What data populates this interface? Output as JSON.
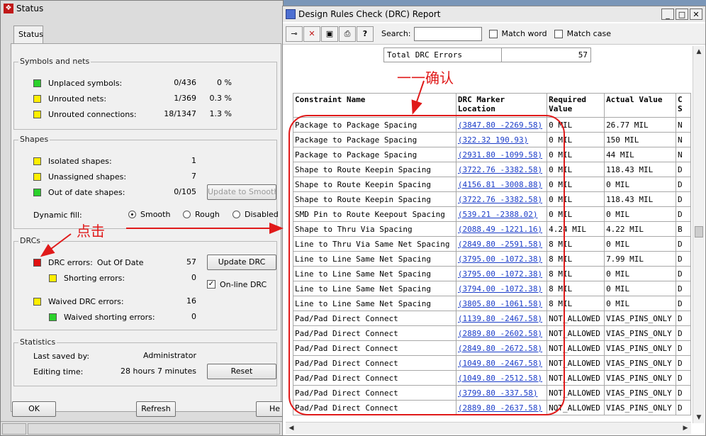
{
  "status_window": {
    "title": "Status",
    "tab": "Status",
    "symbols_nets": {
      "label": "Symbols and nets",
      "rows": [
        {
          "name": "Unplaced symbols:",
          "count": "0/436",
          "pct": "0 %",
          "color": "#2bd12b"
        },
        {
          "name": "Unrouted nets:",
          "count": "1/369",
          "pct": "0.3 %",
          "color": "#ffee00"
        },
        {
          "name": "Unrouted connections:",
          "count": "18/1347",
          "pct": "1.3 %",
          "color": "#ffee00"
        }
      ]
    },
    "shapes": {
      "label": "Shapes",
      "isolated": {
        "name": "Isolated shapes:",
        "value": "1"
      },
      "unassigned": {
        "name": "Unassigned shapes:",
        "value": "7"
      },
      "out_of_date": {
        "name": "Out of date shapes:",
        "value": "0/105"
      },
      "update_to_smooth": "Update to Smooth",
      "dynamic_fill_label": "Dynamic fill:",
      "fill_options": [
        "Smooth",
        "Rough",
        "Disabled"
      ],
      "fill_selected": "Smooth"
    },
    "drcs": {
      "label": "DRCs",
      "drc_errors": {
        "name": "DRC errors:",
        "state": "Out Of Date",
        "value": "57"
      },
      "shorting_errors": {
        "name": "Shorting errors:",
        "value": "0"
      },
      "waived_drc_errors": {
        "name": "Waived DRC errors:",
        "value": "16"
      },
      "waived_shorting_errors": {
        "name": "Waived shorting errors:",
        "value": "0"
      },
      "update_drc": "Update DRC",
      "online_drc": "On-line DRC"
    },
    "statistics": {
      "label": "Statistics",
      "last_saved_label": "Last saved by:",
      "last_saved_value": "Administrator",
      "editing_time_label": "Editing time:",
      "editing_time_value": "28 hours 7 minutes",
      "reset": "Reset"
    },
    "buttons": {
      "ok": "OK",
      "refresh": "Refresh",
      "help": "He"
    }
  },
  "drc_window": {
    "title": "Design Rules Check (DRC) Report",
    "search_label": "Search:",
    "search_value": "",
    "match_word": "Match word",
    "match_case": "Match case",
    "total_label": "Total DRC Errors",
    "total_value": "57",
    "columns": [
      "Constraint Name",
      "DRC Marker Location",
      "Required Value",
      "Actual Value",
      "C S"
    ],
    "rows": [
      {
        "name": "Package to Package Spacing",
        "loc": "(3847.80 -2269.58)",
        "req": "0 MIL",
        "act": "26.77 MIL",
        "s": "N"
      },
      {
        "name": "Package to Package Spacing",
        "loc": "(322.32 190.93)",
        "req": "0 MIL",
        "act": "150 MIL",
        "s": "N"
      },
      {
        "name": "Package to Package Spacing",
        "loc": "(2931.80 -1099.58)",
        "req": "0 MIL",
        "act": "44 MIL",
        "s": "N"
      },
      {
        "name": "Shape to Route Keepin Spacing",
        "loc": "(3722.76 -3382.58)",
        "req": "0 MIL",
        "act": "118.43 MIL",
        "s": "D"
      },
      {
        "name": "Shape to Route Keepin Spacing",
        "loc": "(4156.81 -3008.88)",
        "req": "0 MIL",
        "act": "0 MIL",
        "s": "D"
      },
      {
        "name": "Shape to Route Keepin Spacing",
        "loc": "(3722.76 -3382.58)",
        "req": "0 MIL",
        "act": "118.43 MIL",
        "s": "D"
      },
      {
        "name": "SMD Pin to Route Keepout Spacing",
        "loc": "(539.21 -2388.02)",
        "req": "0 MIL",
        "act": "0 MIL",
        "s": "D"
      },
      {
        "name": "Shape to Thru Via Spacing",
        "loc": "(2088.49 -1221.16)",
        "req": "4.24 MIL",
        "act": "4.22 MIL",
        "s": "B"
      },
      {
        "name": "Line to Thru Via Same Net Spacing",
        "loc": "(2849.80 -2591.58)",
        "req": "8 MIL",
        "act": "0 MIL",
        "s": "D"
      },
      {
        "name": "Line to Line Same Net Spacing",
        "loc": "(3795.00 -1072.38)",
        "req": "8 MIL",
        "act": "7.99 MIL",
        "s": "D"
      },
      {
        "name": "Line to Line Same Net Spacing",
        "loc": "(3795.00 -1072.38)",
        "req": "8 MIL",
        "act": "0 MIL",
        "s": "D"
      },
      {
        "name": "Line to Line Same Net Spacing",
        "loc": "(3794.00 -1072.38)",
        "req": "8 MIL",
        "act": "0 MIL",
        "s": "D"
      },
      {
        "name": "Line to Line Same Net Spacing",
        "loc": "(3805.80 -1061.58)",
        "req": "8 MIL",
        "act": "0 MIL",
        "s": "D"
      },
      {
        "name": "Pad/Pad Direct Connect",
        "loc": "(1139.80 -2467.58)",
        "req": "NOT_ALLOWED",
        "act": "VIAS_PINS_ONLY",
        "s": "D"
      },
      {
        "name": "Pad/Pad Direct Connect",
        "loc": "(2889.80 -2602.58)",
        "req": "NOT_ALLOWED",
        "act": "VIAS_PINS_ONLY",
        "s": "D"
      },
      {
        "name": "Pad/Pad Direct Connect",
        "loc": "(2849.80 -2672.58)",
        "req": "NOT_ALLOWED",
        "act": "VIAS_PINS_ONLY",
        "s": "D"
      },
      {
        "name": "Pad/Pad Direct Connect",
        "loc": "(1049.80 -2467.58)",
        "req": "NOT_ALLOWED",
        "act": "VIAS_PINS_ONLY",
        "s": "D"
      },
      {
        "name": "Pad/Pad Direct Connect",
        "loc": "(1049.80 -2512.58)",
        "req": "NOT_ALLOWED",
        "act": "VIAS_PINS_ONLY",
        "s": "D"
      },
      {
        "name": "Pad/Pad Direct Connect",
        "loc": "(3799.80 -337.58)",
        "req": "NOT_ALLOWED",
        "act": "VIAS_PINS_ONLY",
        "s": "D"
      },
      {
        "name": "Pad/Pad Direct Connect",
        "loc": "(2889.80 -2637.58)",
        "req": "NOT_ALLOWED",
        "act": "VIAS_PINS_ONLY",
        "s": "D"
      }
    ]
  },
  "annotations": {
    "click_text": "点击",
    "confirm_text": "一一确认",
    "color": "#e01a1a"
  }
}
